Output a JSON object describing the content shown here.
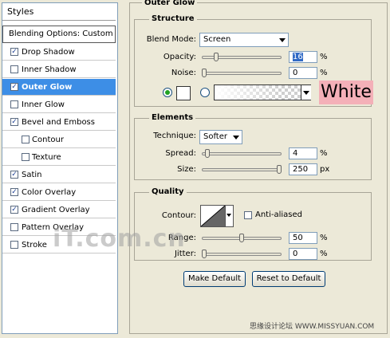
{
  "styles_panel": {
    "header": "Styles",
    "blending_options": "Blending Options: Custom",
    "items": [
      {
        "label": "Drop Shadow",
        "checked": true
      },
      {
        "label": "Inner Shadow",
        "checked": false
      },
      {
        "label": "Outer Glow",
        "checked": true,
        "selected": true
      },
      {
        "label": "Inner Glow",
        "checked": false
      },
      {
        "label": "Bevel and Emboss",
        "checked": true
      },
      {
        "label": "Contour",
        "checked": false,
        "indent": true
      },
      {
        "label": "Texture",
        "checked": false,
        "indent": true
      },
      {
        "label": "Satin",
        "checked": true
      },
      {
        "label": "Color Overlay",
        "checked": true
      },
      {
        "label": "Gradient Overlay",
        "checked": true
      },
      {
        "label": "Pattern Overlay",
        "checked": false
      },
      {
        "label": "Stroke",
        "checked": false
      }
    ]
  },
  "outer_glow": {
    "title": "Outer Glow",
    "structure": {
      "title": "Structure",
      "blend_mode_label": "Blend Mode:",
      "blend_mode_value": "Screen",
      "opacity_label": "Opacity:",
      "opacity_value": "16",
      "opacity_unit": "%",
      "opacity_level": 0.16,
      "noise_label": "Noise:",
      "noise_value": "0",
      "noise_unit": "%",
      "noise_level": 0,
      "color_callout": "White"
    },
    "elements": {
      "title": "Elements",
      "technique_label": "Technique:",
      "technique_value": "Softer",
      "spread_label": "Spread:",
      "spread_value": "4",
      "spread_unit": "%",
      "spread_level": 0.04,
      "size_label": "Size:",
      "size_value": "250",
      "size_unit": "px",
      "size_level": 1.0
    },
    "quality": {
      "title": "Quality",
      "contour_label": "Contour:",
      "anti_aliased_label": "Anti-aliased",
      "anti_aliased_checked": false,
      "range_label": "Range:",
      "range_value": "50",
      "range_unit": "%",
      "range_level": 0.5,
      "jitter_label": "Jitter:",
      "jitter_value": "0",
      "jitter_unit": "%",
      "jitter_level": 0
    },
    "make_default_label": "Make Default",
    "reset_default_label": "Reset to Default"
  },
  "watermarks": {
    "main": "iT.com.cn",
    "site": "思缘设计论坛 WWW.MISSYUAN.COM"
  },
  "colors": {
    "selection": "#3d8ee6",
    "callout_bg": "#f4b0b8",
    "glow_color": "#ffffff"
  }
}
